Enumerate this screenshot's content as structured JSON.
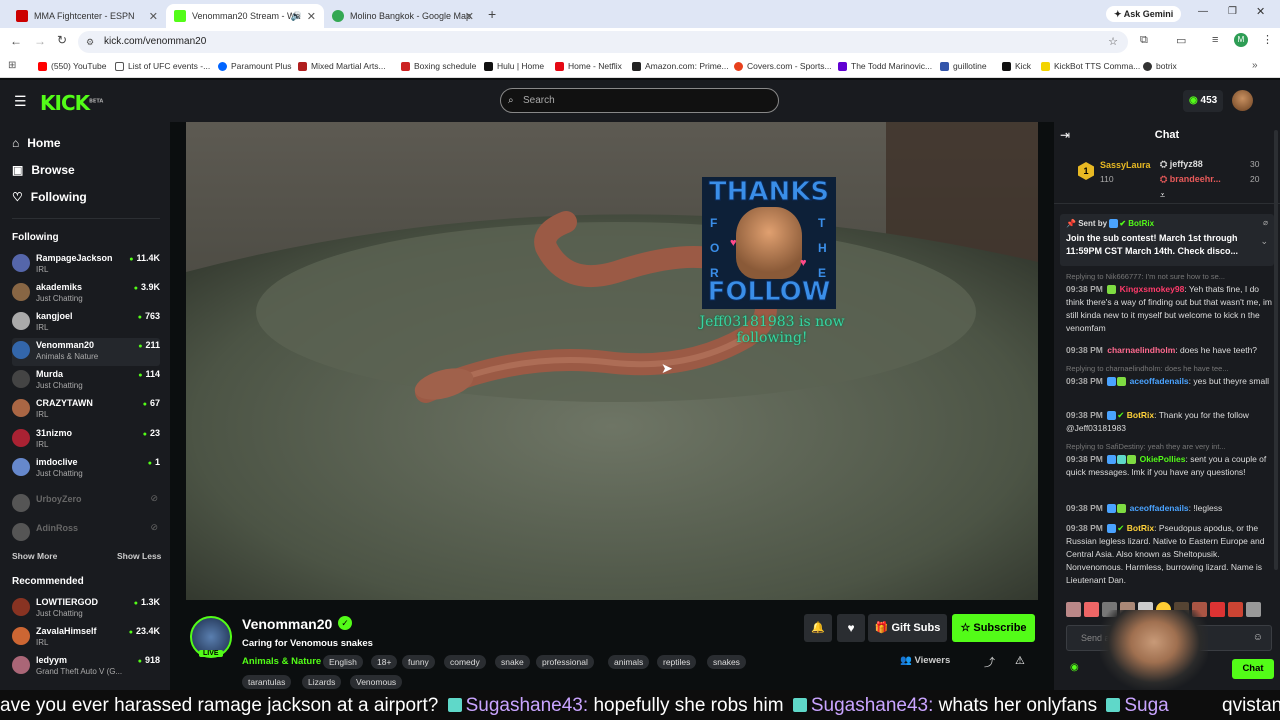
{
  "browser": {
    "tabs": [
      {
        "label": "MMA Fightcenter - ESPN",
        "color": "#cc0000"
      },
      {
        "label": "Venomman20 Stream - Wa",
        "color": "#53fc18"
      },
      {
        "label": "Molino Bangkok - Google Map",
        "color": "#34a853"
      }
    ],
    "ask_gemini": "Ask Gemini",
    "url": "kick.com/venomman20",
    "profile_initial": "M",
    "bookmarks": [
      "(550) YouTube",
      "List of UFC events -...",
      "Paramount Plus",
      "Mixed Martial Arts...",
      "Boxing schedule",
      "Hulu | Home",
      "Home - Netflix",
      "Amazon.com: Prime...",
      "Covers.com - Sports...",
      "The Todd Marinovic...",
      "guillotine",
      "Kick",
      "KickBot TTS Comma...",
      "botrix"
    ]
  },
  "header": {
    "logo": "KICK",
    "logo_sup": "BETA",
    "search_placeholder": "Search",
    "points": "453"
  },
  "sidebar": {
    "nav": [
      "Home",
      "Browse",
      "Following"
    ],
    "following_heading": "Following",
    "following": [
      {
        "name": "RampageJackson",
        "category": "IRL",
        "viewers": "11.4K",
        "color": "#5566aa"
      },
      {
        "name": "akademiks",
        "category": "Just Chatting",
        "viewers": "3.9K",
        "color": "#886644"
      },
      {
        "name": "kangjoel",
        "category": "IRL",
        "viewers": "763",
        "color": "#aaaaaa"
      },
      {
        "name": "Venomman20",
        "category": "Animals & Nature",
        "viewers": "211",
        "color": "#3366aa"
      },
      {
        "name": "Murda",
        "category": "Just Chatting",
        "viewers": "114",
        "color": "#444444"
      },
      {
        "name": "CRAZYTAWN",
        "category": "IRL",
        "viewers": "67",
        "color": "#aa6644"
      },
      {
        "name": "31nizmo",
        "category": "IRL",
        "viewers": "23",
        "color": "#aa2233"
      },
      {
        "name": "imdoclive",
        "category": "Just Chatting",
        "viewers": "1",
        "color": "#6688cc"
      },
      {
        "name": "UrboyZero",
        "category": "",
        "viewers": "",
        "color": "#555555"
      },
      {
        "name": "AdinRoss",
        "category": "",
        "viewers": "",
        "color": "#555555"
      }
    ],
    "show_more": "Show More",
    "show_less": "Show Less",
    "recommended_heading": "Recommended",
    "recommended": [
      {
        "name": "LOWTIERGOD",
        "category": "Just Chatting",
        "viewers": "1.3K",
        "color": "#883322"
      },
      {
        "name": "ZavalaHimself",
        "category": "IRL",
        "viewers": "23.4K",
        "color": "#cc6633"
      },
      {
        "name": "ledyym",
        "category": "Grand Theft Auto V (G...",
        "viewers": "918",
        "color": "#aa6677"
      }
    ]
  },
  "video": {
    "alert_thanks": "THANKS",
    "alert_for": [
      "F",
      "O",
      "R"
    ],
    "alert_the": [
      "T",
      "H",
      "E"
    ],
    "alert_follow": "FOLLOW",
    "alert_text": "Jeff03181983 is now following!"
  },
  "stream": {
    "streamer": "Venomman20",
    "title": "Caring for Venomous snakes",
    "live": "LIVE",
    "category": "Animals & Nature",
    "tags": [
      "English",
      "18+",
      "funny",
      "comedy",
      "snake",
      "professional",
      "animals",
      "reptiles",
      "snakes",
      "tarantulas",
      "Lizards",
      "Venomous"
    ],
    "gift_subs": "Gift Subs",
    "subscribe": "Subscribe",
    "viewers_label": "Viewers"
  },
  "chat": {
    "title": "Chat",
    "leaderboard": [
      {
        "rank": "1",
        "name": "SassyLaura",
        "points": "110"
      },
      {
        "name": "jeffyz88",
        "points": "30"
      },
      {
        "name": "brandeehr...",
        "points": "20"
      }
    ],
    "pinned_by_label": "Sent by",
    "pinned_by": "BotRix",
    "pinned_text": "Join the sub contest! March 1st through 11:59PM CST March 14th. Check disco...",
    "messages": [
      {
        "reply": "Replying to Nik666777: I'm not sure how to se...",
        "time": "09:38 PM",
        "user": "Kingxsmokey98",
        "ucolor": "#ff3b6b",
        "text": "Yeh thats fine, I do think there's a way of finding out but that wasn't me, im still kinda new to it myself but welcome to kick n the venomfam"
      },
      {
        "reply": "",
        "time": "09:38 PM",
        "user": "charnaelindholm",
        "ucolor": "#ff6a8f",
        "text": "does he have teeth?"
      },
      {
        "reply": "Replying to charnaelindholm: does he have tee...",
        "time": "09:38 PM",
        "user": "aceoffadenails",
        "ucolor": "#4aa3ff",
        "text": "yes but theyre small"
      },
      {
        "reply": "",
        "time": "09:38 PM",
        "user": "BotRix",
        "ucolor": "#ffd23a",
        "text": "Thank you for the follow @Jeff03181983"
      },
      {
        "reply": "Replying to SafiDestiny: yeah they are very int...",
        "time": "09:38 PM",
        "user": "OkiePollies",
        "ucolor": "#53fc18",
        "text": "sent you a couple of quick messages. lmk if you have any questions!"
      },
      {
        "reply": "",
        "time": "09:38 PM",
        "user": "aceoffadenails",
        "ucolor": "#4aa3ff",
        "text": "!legless"
      },
      {
        "reply": "",
        "time": "09:38 PM",
        "user": "BotRix",
        "ucolor": "#ffd23a",
        "text": "Pseudopus apodus, or the Russian legless lizard. Native to Eastern Europe and Central Asia. Also known as Sheltopusik. Nonvenomous. Harmless, burrowing lizard. Name is Lieutenant Dan."
      }
    ],
    "input_placeholder": "Send a message",
    "chat_button": "Chat"
  },
  "ticker": [
    {
      "type": "text",
      "value": "ave you ever harassed ramage jackson at a airport?"
    },
    {
      "type": "user",
      "value": "Sugashane43:"
    },
    {
      "type": "text",
      "value": "hopefully she robs him"
    },
    {
      "type": "user",
      "value": "Sugashane43:"
    },
    {
      "type": "text",
      "value": "whats her onlyfans"
    },
    {
      "type": "user",
      "value": "Suga"
    },
    {
      "type": "text",
      "value": "qvistan"
    }
  ]
}
